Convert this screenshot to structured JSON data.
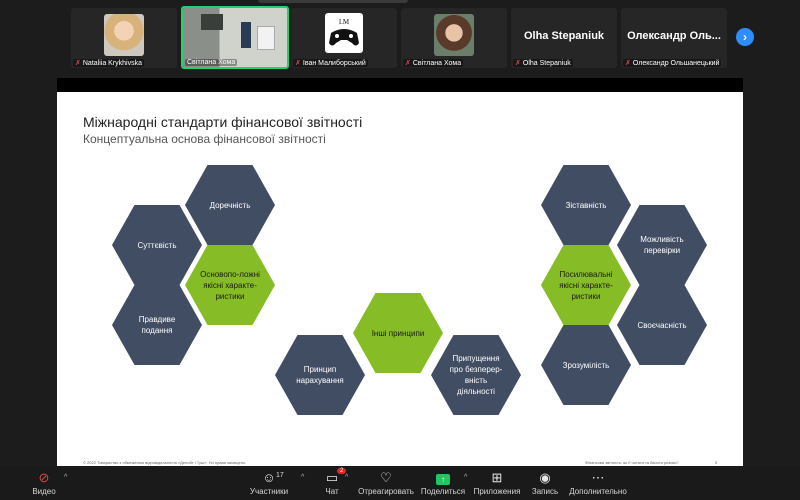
{
  "participants": [
    {
      "name": "Nataliia Krykhivska",
      "muted": true
    },
    {
      "name": "Світлана Хома",
      "muted": false
    },
    {
      "name": "Іван Малиборський",
      "muted": true
    },
    {
      "name": "Світлана Хома",
      "muted": true
    },
    {
      "name": "Olha Stepaniuk",
      "display": "Olha Stepaniuk",
      "muted": true
    },
    {
      "name": "Олександр Ольшанецький",
      "display": "Олександр Оль...",
      "muted": true
    }
  ],
  "slide": {
    "title": "Міжнародні стандарти фінансової звітності",
    "subtitle": "Концептуальна основа фінансової звітності",
    "left_cluster": {
      "center": "Основопо-ложні якісні характе-ристики",
      "items": [
        "Доречність",
        "Суттєвість",
        "Правдиве подання"
      ]
    },
    "middle_cluster": {
      "center": "Інші принципи",
      "items": [
        "Принцип нарахування",
        "Припущення про безперер-вність діяльності"
      ]
    },
    "right_cluster": {
      "center": "Посилювальні якісні характе-ристики",
      "items": [
        "Зіставність",
        "Можливість перевірки",
        "Своєчасність",
        "Зрозумілість"
      ]
    },
    "footer_left": "© 2022 Товариство з обмеженою відповідальністю «Делойт і Туш». Усі права захищено.",
    "footer_right": "Фінансова звітність: як її читати та бачити ризики?",
    "page_number": "5"
  },
  "toolbar": {
    "video": "Видео",
    "participants": "Участники",
    "participants_count": "17",
    "chat": "Чат",
    "chat_badge": "2",
    "react": "Отреагировать",
    "share": "Поделиться",
    "apps": "Приложения",
    "record": "Запись",
    "more": "Дополнительно"
  },
  "colors": {
    "hex_dark": "#414d63",
    "hex_green": "#86bc25",
    "active_border": "#1fd26b"
  }
}
